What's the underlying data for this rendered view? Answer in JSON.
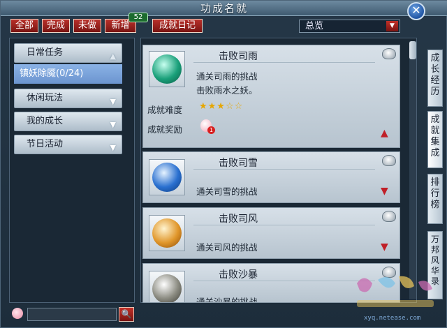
{
  "window": {
    "title": "功成名就"
  },
  "toolbar": {
    "buttons": [
      "全部",
      "完成",
      "未做",
      "新增",
      "成就日记"
    ],
    "new_count": "52",
    "dropdown_value": "总览"
  },
  "categories": [
    {
      "label": "日常任务",
      "expanded": true
    },
    {
      "label": "休闲玩法",
      "expanded": false
    },
    {
      "label": "我的成长",
      "expanded": false
    },
    {
      "label": "节日活动",
      "expanded": false
    }
  ],
  "selected_sub": "镇妖除魇(0/24)",
  "search": {
    "value": ""
  },
  "cards": [
    {
      "title": "击败司雨",
      "desc1": "通关司雨的挑战",
      "desc2": "击败雨水之妖。",
      "difficulty_label": "成就难度",
      "difficulty_stars": "★★★☆☆",
      "reward_label": "成就奖励",
      "reward_count": "1",
      "orb_color": "#1aa07a"
    },
    {
      "title": "击败司雪",
      "desc1": "通关司雪的挑战",
      "orb_color": "#2a70d0"
    },
    {
      "title": "击败司风",
      "desc1": "通关司风的挑战",
      "orb_color": "#e0962a"
    },
    {
      "title": "击败沙暴",
      "desc1": "通关沙暴的挑战",
      "orb_color": "#8a8a80"
    }
  ],
  "side_tabs": [
    "成长经历",
    "成就集成",
    "排行榜",
    "万邦风华录"
  ],
  "watermark": {
    "site": "xyq.netease.com"
  },
  "colors": {
    "accent_red": "#b02520",
    "selected_blue": "#7aa5dc"
  }
}
